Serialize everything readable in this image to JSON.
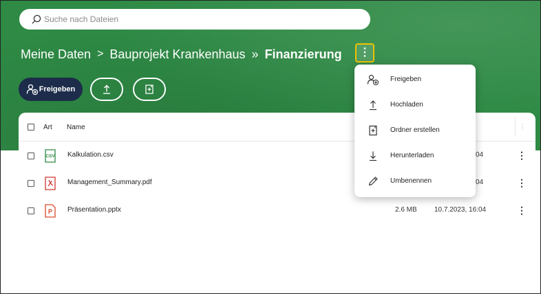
{
  "search": {
    "placeholder": "Suche nach Dateien"
  },
  "breadcrumb": {
    "root": "Meine Daten",
    "sep1": ">",
    "middle": "Bauprojekt Krankenhaus",
    "sep2": "»",
    "current": "Finanzierung"
  },
  "toolbar": {
    "share_label": "Freigeben"
  },
  "table": {
    "columns": {
      "type": "Art",
      "name": "Name"
    },
    "rows": [
      {
        "icon": "csv-file-icon",
        "name": "Kalkulation.csv",
        "size": "",
        "date_partial": "04"
      },
      {
        "icon": "pdf-file-icon",
        "name": "Management_Summary.pdf",
        "size": "",
        "date_partial": "04"
      },
      {
        "icon": "pptx-file-icon",
        "name": "Präsentation.pptx",
        "size": "2.6 MB",
        "date": "10.7.2023, 16:04"
      }
    ]
  },
  "context_menu": {
    "items": [
      {
        "icon": "share-user-icon",
        "label": "Freigeben"
      },
      {
        "icon": "upload-icon",
        "label": "Hochladen"
      },
      {
        "icon": "new-folder-icon",
        "label": "Ordner erstellen"
      },
      {
        "icon": "download-icon",
        "label": "Herunterladen"
      },
      {
        "icon": "pencil-icon",
        "label": "Umbenennen"
      }
    ]
  },
  "colors": {
    "brand_green": "#2e8a45",
    "navy": "#1c2c4a",
    "highlight": "#f2c200",
    "csv": "#2e8a45",
    "pdf": "#d0342c",
    "pptx": "#d9482b"
  }
}
